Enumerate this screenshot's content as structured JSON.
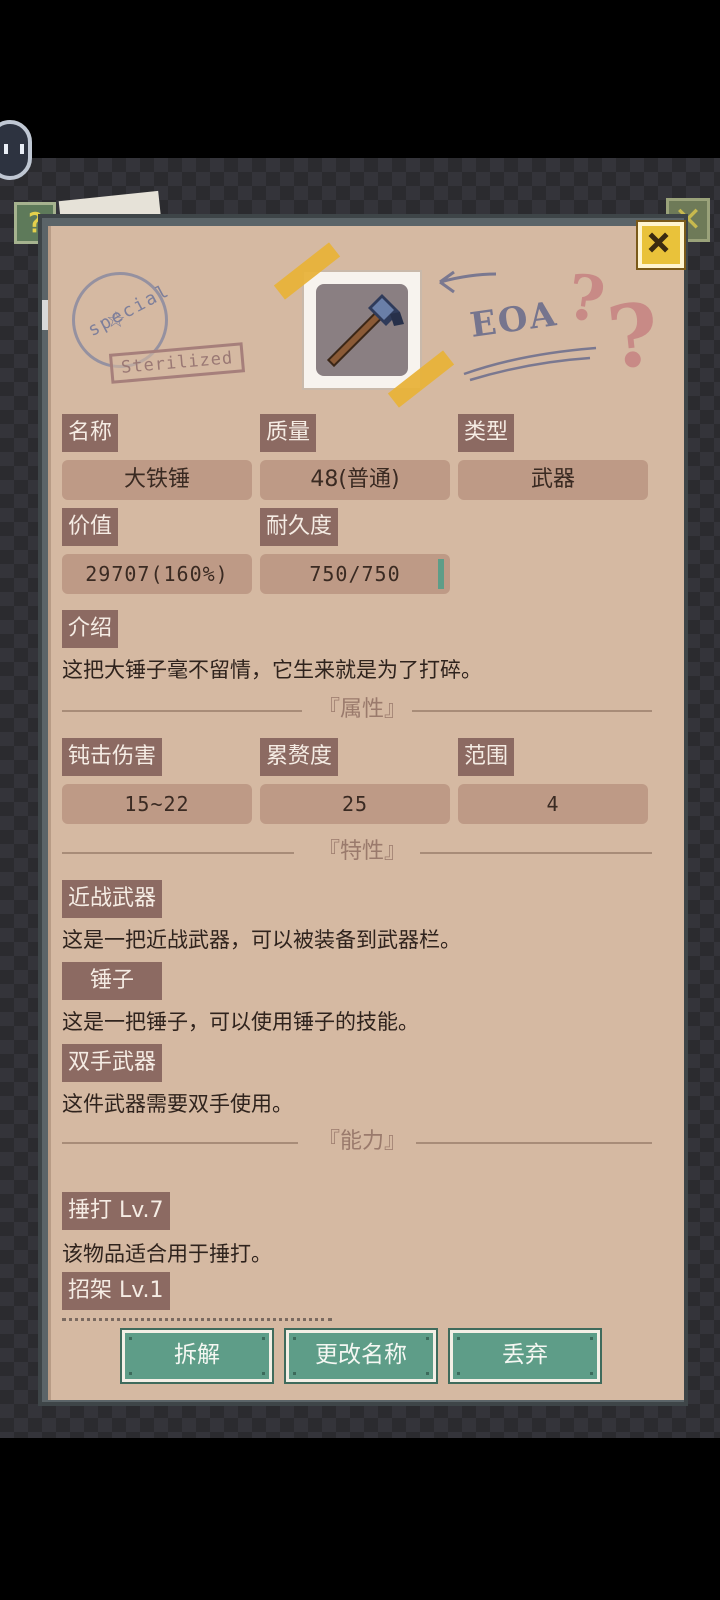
{
  "header": {
    "stamp_circle_text": "special",
    "stamp_rect_text": "Sterilized",
    "doodle_text": "EOA",
    "question_marks": [
      "?",
      "?"
    ],
    "item_icon": "hammer-icon"
  },
  "fields": {
    "name_label": "名称",
    "name_value": "大铁锤",
    "quality_label": "质量",
    "quality_value": "48(普通)",
    "type_label": "类型",
    "type_value": "武器",
    "value_label": "价值",
    "value_value": "29707(160%)",
    "durability_label": "耐久度",
    "durability_value": "750/750",
    "durability_fraction": 1.0
  },
  "intro": {
    "label": "介绍",
    "text": "这把大锤子毫不留情，它生来就是为了打碎。"
  },
  "attributes": {
    "section_title": "『属性』",
    "items": [
      {
        "label": "钝击伤害",
        "value": "15~22"
      },
      {
        "label": "累赘度",
        "value": "25"
      },
      {
        "label": "范围",
        "value": "4"
      }
    ]
  },
  "traits": {
    "section_title": "『特性』",
    "items": [
      {
        "label": "近战武器",
        "text": "这是一把近战武器，可以被装备到武器栏。"
      },
      {
        "label": "锤子",
        "text": "这是一把锤子，可以使用锤子的技能。"
      },
      {
        "label": "双手武器",
        "text": "这件武器需要双手使用。"
      }
    ]
  },
  "abilities": {
    "section_title": "『能力』",
    "items": [
      {
        "label": "捶打 Lv.7",
        "text": "该物品适合用于捶打。"
      },
      {
        "label": "招架 Lv.1",
        "text": ""
      }
    ]
  },
  "buttons": {
    "disassemble": "拆解",
    "rename": "更改名称",
    "discard": "丢弃"
  },
  "colors": {
    "panel": "#d5b9a2",
    "tag": "#8c6a62",
    "value_box": "#be9a86",
    "button": "#5e9d88",
    "close": "#e9c23a"
  }
}
